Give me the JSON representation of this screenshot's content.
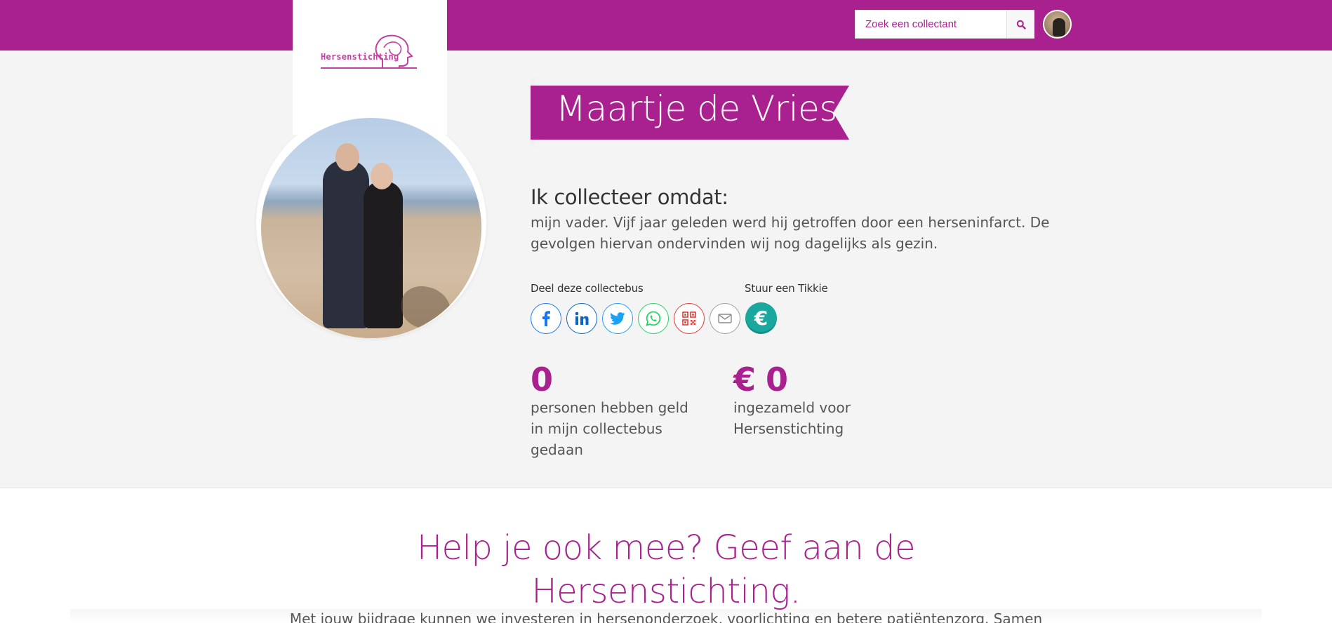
{
  "header": {
    "logo_text": "Hersenstichting",
    "search": {
      "placeholder": "Zoek een collectant",
      "value": ""
    },
    "search_icon": "search-icon",
    "user_avatar": "user-avatar"
  },
  "profile": {
    "name": "Maartje de Vries",
    "reason_heading": "Ik collecteer omdat:",
    "reason_text": "mijn vader. Vijf jaar geleden werd hij getroffen door een herseninfarct. De gevolgen hiervan ondervinden wij nog dagelijks als gezin."
  },
  "share": {
    "label": "Deel deze collectebus",
    "tikkie_label": "Stuur een Tikkie",
    "buttons": [
      {
        "icon": "facebook-icon",
        "color": "#3b5998"
      },
      {
        "icon": "linkedin-icon",
        "color": "#0a66c2"
      },
      {
        "icon": "twitter-icon",
        "color": "#1da1f2"
      },
      {
        "icon": "whatsapp-icon",
        "color": "#25d366"
      },
      {
        "icon": "qr-code-icon",
        "color": "#e53935"
      },
      {
        "icon": "email-icon",
        "color": "#888888"
      }
    ],
    "tikkie_symbol": "€"
  },
  "stats": {
    "donors_count": "0",
    "donors_label": "personen hebben geld in mijn collectebus gedaan",
    "amount": "€ 0",
    "amount_label": "ingezameld voor Hersenstichting"
  },
  "cta": {
    "title_line1": "Help je ook mee? Geef aan de",
    "title_line2": "Hersenstichting.",
    "subtitle": "Met jouw bijdrage kunnen we investeren in hersenonderzoek, voorlichting en betere patiëntenzorg. Samen"
  },
  "colors": {
    "brand": "#a9208f",
    "background": "#f4f4f4",
    "tikkie": "#1aa89e"
  }
}
